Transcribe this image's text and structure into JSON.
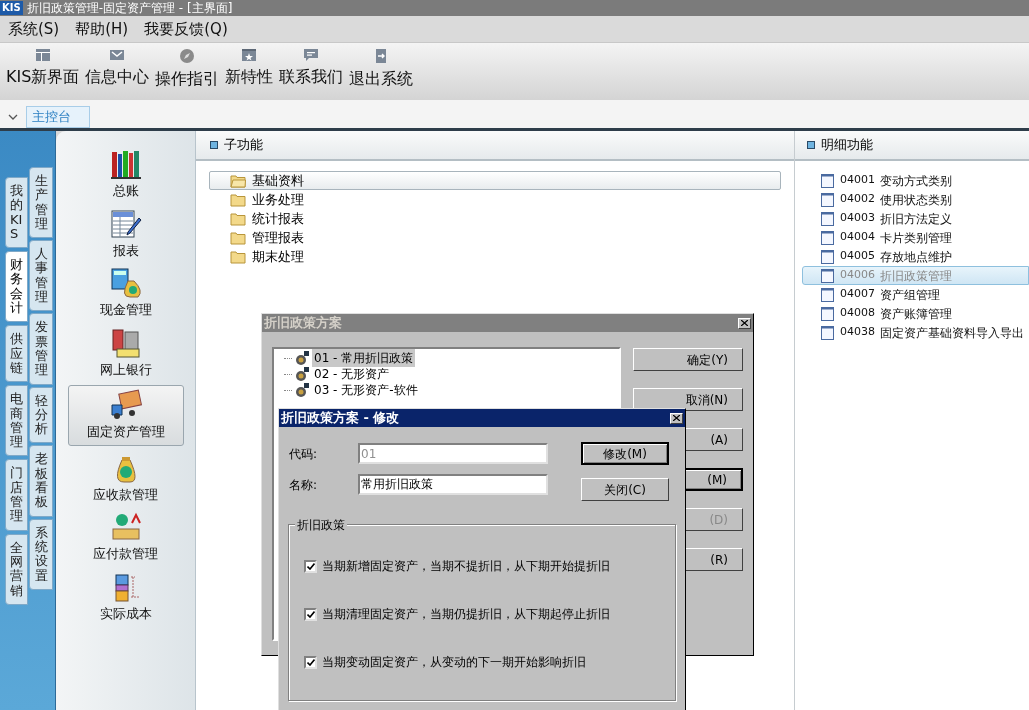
{
  "window": {
    "logo": "KIS",
    "title": "折旧政策管理-固定资产管理 - [主界面]"
  },
  "menu": [
    "系统(S)",
    "帮助(H)",
    "我要反馈(Q)"
  ],
  "toolbar": [
    "KIS新界面",
    "信息中心",
    "操作指引",
    "新特性",
    "联系我们",
    "退出系统"
  ],
  "tabs": [
    {
      "label": "主控台",
      "selected": true
    }
  ],
  "side_tabs": {
    "column_1": [
      {
        "label": "我的KIS",
        "selected": false
      },
      {
        "label": "财务会计",
        "selected": true
      },
      {
        "label": "供应链",
        "selected": false
      },
      {
        "label": "电商管理",
        "selected": false
      },
      {
        "label": "门店管理",
        "selected": false
      },
      {
        "label": "全网营销",
        "selected": false
      }
    ],
    "column_2": [
      {
        "label": "生产管理",
        "selected": false
      },
      {
        "label": "人事管理",
        "selected": false
      },
      {
        "label": "发票管理",
        "selected": false
      },
      {
        "label": "轻分析",
        "selected": false
      },
      {
        "label": "老板看板",
        "selected": false
      },
      {
        "label": "系统设置",
        "selected": false
      }
    ]
  },
  "modules": [
    {
      "label": "总账",
      "selected": false
    },
    {
      "label": "报表",
      "selected": false
    },
    {
      "label": "现金管理",
      "selected": false
    },
    {
      "label": "网上银行",
      "selected": false
    },
    {
      "label": "固定资产管理",
      "selected": true
    },
    {
      "label": "应收款管理",
      "selected": false
    },
    {
      "label": "应付款管理",
      "selected": false
    },
    {
      "label": "实际成本",
      "selected": false
    }
  ],
  "sub_functions": {
    "title": "子功能",
    "items": [
      {
        "label": "基础资料",
        "selected": true
      },
      {
        "label": "业务处理",
        "selected": false
      },
      {
        "label": "统计报表",
        "selected": false
      },
      {
        "label": "管理报表",
        "selected": false
      },
      {
        "label": "期末处理",
        "selected": false
      }
    ]
  },
  "detail_functions": {
    "title": "明细功能",
    "items": [
      {
        "code": "04001",
        "label": "变动方式类别",
        "selected": false
      },
      {
        "code": "04002",
        "label": "使用状态类别",
        "selected": false
      },
      {
        "code": "04003",
        "label": "折旧方法定义",
        "selected": false
      },
      {
        "code": "04004",
        "label": "卡片类别管理",
        "selected": false
      },
      {
        "code": "04005",
        "label": "存放地点维护",
        "selected": false
      },
      {
        "code": "04006",
        "label": "折旧政策管理",
        "selected": true
      },
      {
        "code": "04007",
        "label": "资产组管理",
        "selected": false
      },
      {
        "code": "04008",
        "label": "资产账簿管理",
        "selected": false
      },
      {
        "code": "04038",
        "label": "固定资产基础资料导入导出",
        "selected": false
      }
    ]
  },
  "policy_dialog": {
    "title": "折旧政策方案",
    "active": false,
    "schemes": [
      {
        "label": "01 - 常用折旧政策",
        "selected": true
      },
      {
        "label": "02 - 无形资产",
        "selected": false
      },
      {
        "label": "03 - 无形资产-软件",
        "selected": false
      }
    ],
    "buttons": [
      {
        "label": "确定(Y)",
        "default": false,
        "disabled": false
      },
      {
        "label": "取消(N)",
        "default": false,
        "disabled": false
      },
      {
        "label": "(A)",
        "default": false,
        "disabled": false
      },
      {
        "label": "(M)",
        "default": true,
        "disabled": false
      },
      {
        "label": "(D)",
        "default": false,
        "disabled": true
      },
      {
        "label": "(R)",
        "default": false,
        "disabled": false
      }
    ]
  },
  "edit_dialog": {
    "title": "折旧政策方案 - 修改",
    "active": true,
    "fields": [
      {
        "label": "代码:",
        "value": "01",
        "disabled": true
      },
      {
        "label": "名称:",
        "value": "常用折旧政策",
        "disabled": false
      }
    ],
    "buttons": [
      {
        "label": "修改(M)",
        "default": true
      },
      {
        "label": "关闭(C)",
        "default": false
      }
    ],
    "group": {
      "title": "折旧政策",
      "options": [
        {
          "label": "当期新增固定资产，当期不提折旧，从下期开始提折旧",
          "checked": true
        },
        {
          "label": "当期清理固定资产，当期仍提折旧，从下期起停止折旧",
          "checked": true
        },
        {
          "label": "当期变动固定资产，从变动的下一期开始影响折旧",
          "checked": true
        }
      ]
    }
  }
}
